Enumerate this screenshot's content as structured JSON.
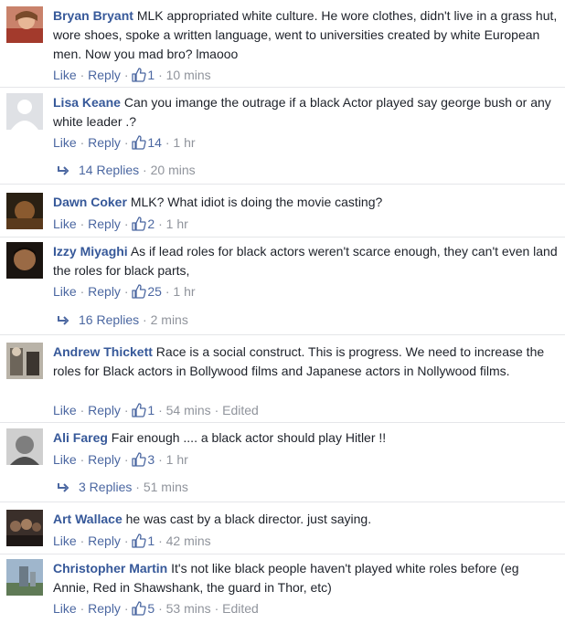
{
  "labels": {
    "like": "Like",
    "reply": "Reply",
    "dot": "·"
  },
  "comments": [
    {
      "name": "Bryan Bryant",
      "text": "MLK appropriated white culture. He wore clothes, didn't live in a grass hut, wore shoes, spoke a written language, went to universities created by white European men. Now you mad bro? lmaooo",
      "likes": "1",
      "time": "10 mins",
      "edited": ""
    },
    {
      "name": "Lisa Keane",
      "text": "Can you imange the outrage if a black Actor played say george bush or any white leader .?",
      "likes": "14",
      "time": "1 hr",
      "edited": "",
      "replies_label": "14 Replies",
      "replies_time": "20 mins"
    },
    {
      "name": "Dawn Coker",
      "text": "MLK? What idiot is doing the movie casting?",
      "likes": "2",
      "time": "1 hr",
      "edited": ""
    },
    {
      "name": "Izzy Miyaghi",
      "text": "As if lead roles for black actors weren't scarce enough, they can't even land the roles for black parts,",
      "likes": "25",
      "time": "1 hr",
      "edited": "",
      "replies_label": "16 Replies",
      "replies_time": "2 mins"
    },
    {
      "name": "Andrew Thickett",
      "text": "Race is a social construct. This is progress. We need to increase the roles for Black actors in Bollywood films and Japanese actors in Nollywood films.",
      "likes": "1",
      "time": "54 mins",
      "edited": "Edited"
    },
    {
      "name": "Ali Fareg",
      "text": "Fair enough .... a black actor should play Hitler !!",
      "likes": "3",
      "time": "1 hr",
      "edited": "",
      "replies_label": "3 Replies",
      "replies_time": "51 mins"
    },
    {
      "name": "Art Wallace",
      "text": "he was cast by a black director. just saying.",
      "likes": "1",
      "time": "42 mins",
      "edited": ""
    },
    {
      "name": "Christopher Martin",
      "text": "It's not like black people haven't played white roles before (eg Annie, Red in Shawshank, the guard in Thor, etc)",
      "likes": "5",
      "time": "53 mins",
      "edited": "Edited"
    }
  ],
  "icons": {
    "like": "thumbs-up-icon",
    "reply_arrow": "reply-arrow-icon"
  },
  "colors": {
    "name": "#365899",
    "link": "#4b67a1",
    "meta": "#90949c",
    "text": "#1d2129"
  }
}
